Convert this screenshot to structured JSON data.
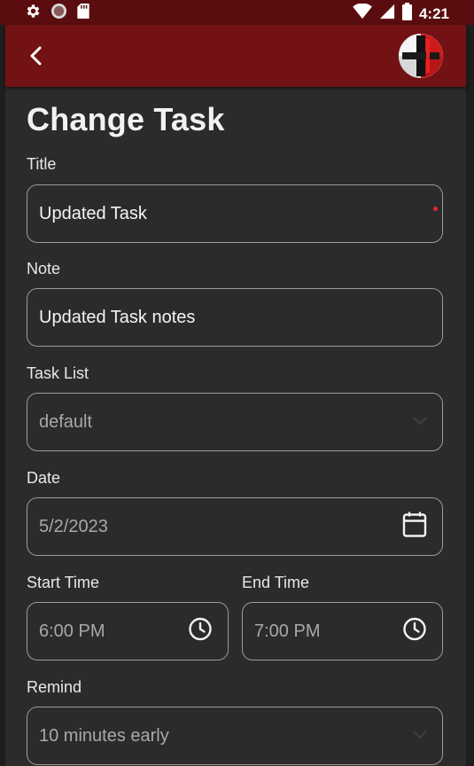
{
  "status_bar": {
    "time": "4:21",
    "icons": [
      "gear-icon",
      "circle-icon",
      "sd-card-icon",
      "wifi-icon",
      "signal-icon",
      "battery-icon"
    ]
  },
  "app_bar": {
    "back_icon": "chevron-left-icon",
    "avatar": "app-logo-avatar"
  },
  "page": {
    "title": "Change Task"
  },
  "form": {
    "title": {
      "label": "Title",
      "value": "Updated Task"
    },
    "note": {
      "label": "Note",
      "value": "Updated Task notes"
    },
    "task_list": {
      "label": "Task List",
      "value": "default"
    },
    "date": {
      "label": "Date",
      "value": "5/2/2023"
    },
    "start_time": {
      "label": "Start Time",
      "value": "6:00 PM"
    },
    "end_time": {
      "label": "End Time",
      "value": "7:00 PM"
    },
    "remind": {
      "label": "Remind",
      "value": "10 minutes early"
    }
  },
  "colors": {
    "status_bar": "#5a0c0e",
    "app_bar": "#721215",
    "background": "#2b2b2b",
    "border": "#9a9a9a",
    "accent_dot": "#e02a2a"
  }
}
